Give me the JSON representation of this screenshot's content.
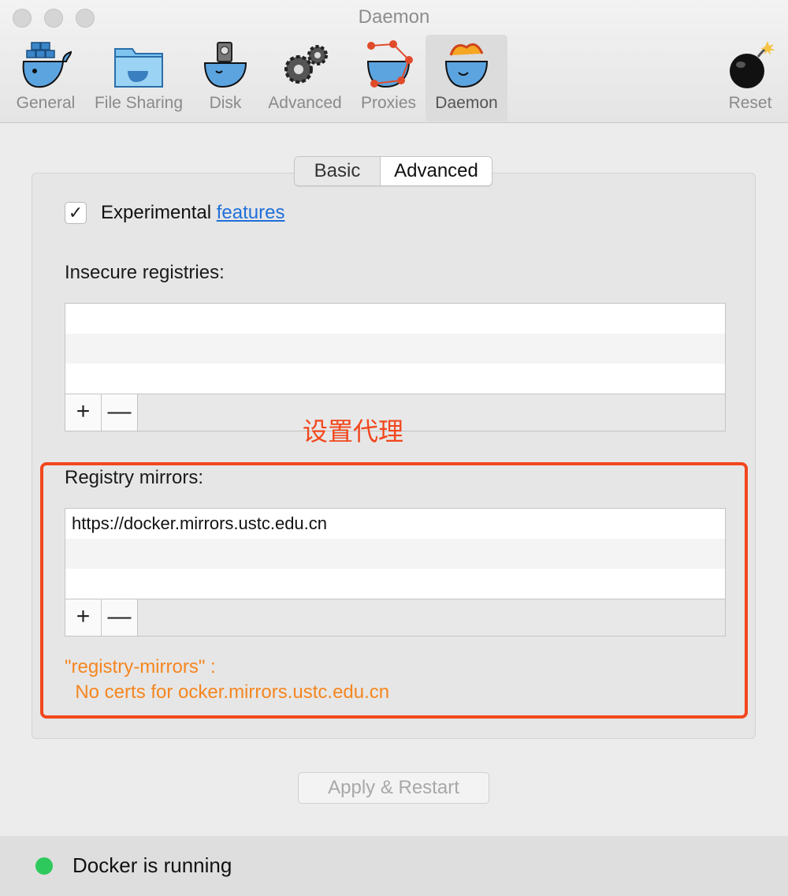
{
  "window": {
    "title": "Daemon"
  },
  "toolbar": {
    "items": [
      {
        "label": "General",
        "icon": "whale-containers-icon"
      },
      {
        "label": "File Sharing",
        "icon": "folder-whale-icon"
      },
      {
        "label": "Disk",
        "icon": "whale-disk-icon"
      },
      {
        "label": "Advanced",
        "icon": "gears-icon"
      },
      {
        "label": "Proxies",
        "icon": "whale-network-icon"
      },
      {
        "label": "Daemon",
        "icon": "whale-devil-icon"
      }
    ],
    "reset": {
      "label": "Reset",
      "icon": "bomb-icon"
    },
    "active": "Daemon"
  },
  "segmented": {
    "basic": "Basic",
    "advanced": "Advanced",
    "selected": "Advanced"
  },
  "experimental": {
    "checked": true,
    "check_glyph": "✓",
    "label": "Experimental",
    "link": "features"
  },
  "insecure_registries": {
    "label": "Insecure registries:",
    "rows": [
      "",
      "",
      ""
    ],
    "add": "+",
    "remove": "—"
  },
  "annotation": {
    "text": "设置代理",
    "color": "#f2471d"
  },
  "registry_mirrors": {
    "label": "Registry mirrors:",
    "rows": [
      "https://docker.mirrors.ustc.edu.cn",
      "",
      ""
    ],
    "add": "+",
    "remove": "—"
  },
  "warning": {
    "line1": "\"registry-mirrors\" :",
    "line2": "  No certs for ocker.mirrors.ustc.edu.cn",
    "color": "#f5861f"
  },
  "apply_button": {
    "label": "Apply & Restart",
    "enabled": false
  },
  "status": {
    "text": "Docker is running",
    "color": "#2ec95c"
  }
}
